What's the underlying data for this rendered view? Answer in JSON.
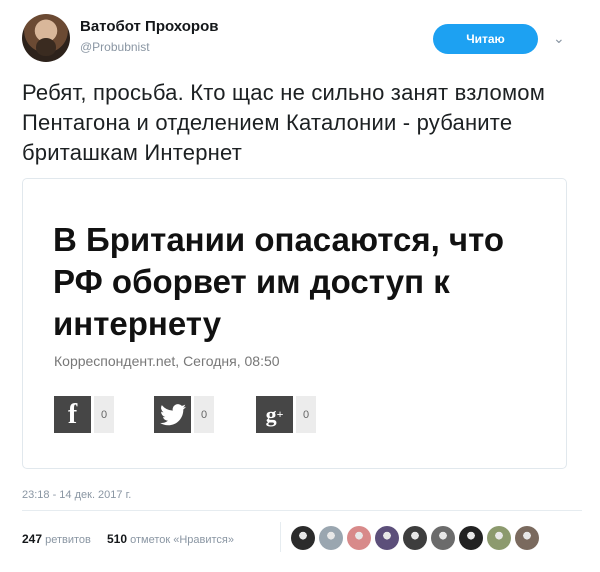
{
  "author": {
    "display_name": "Ватобот Прохоров",
    "handle": "@Probubnist"
  },
  "follow_button": {
    "label": "Читаю"
  },
  "tweet": {
    "text": "Ребят, просьба. Кто щас не сильно занят взломом Пентагона и отделением Каталонии - рубаните бриташкам Интернет",
    "timestamp": "23:18 - 14 дек. 2017 г."
  },
  "card": {
    "headline": "В Британии опасаются, что РФ оборвет им доступ к интернету",
    "source": "Корреспондент.net, Сегодня, 08:50",
    "shares": [
      {
        "network": "facebook",
        "icon": "f",
        "count": "0"
      },
      {
        "network": "twitter",
        "icon": "twitter-bird",
        "count": "0"
      },
      {
        "network": "google-plus",
        "icon": "g+",
        "count": "0"
      }
    ]
  },
  "stats": {
    "retweets_count": "247",
    "retweets_label": "ретвитов",
    "likes_count": "510",
    "likes_label": "отметок «Нравится»"
  },
  "liker_avatar_colors": [
    "#2b2b2b",
    "#9aa6b0",
    "#d88a8a",
    "#5c4f7a",
    "#3d3d3d",
    "#6b6b6b",
    "#222222",
    "#8c9a6e",
    "#7a6a5e"
  ],
  "colors": {
    "accent": "#1da1f2",
    "muted": "#8a96a3"
  }
}
